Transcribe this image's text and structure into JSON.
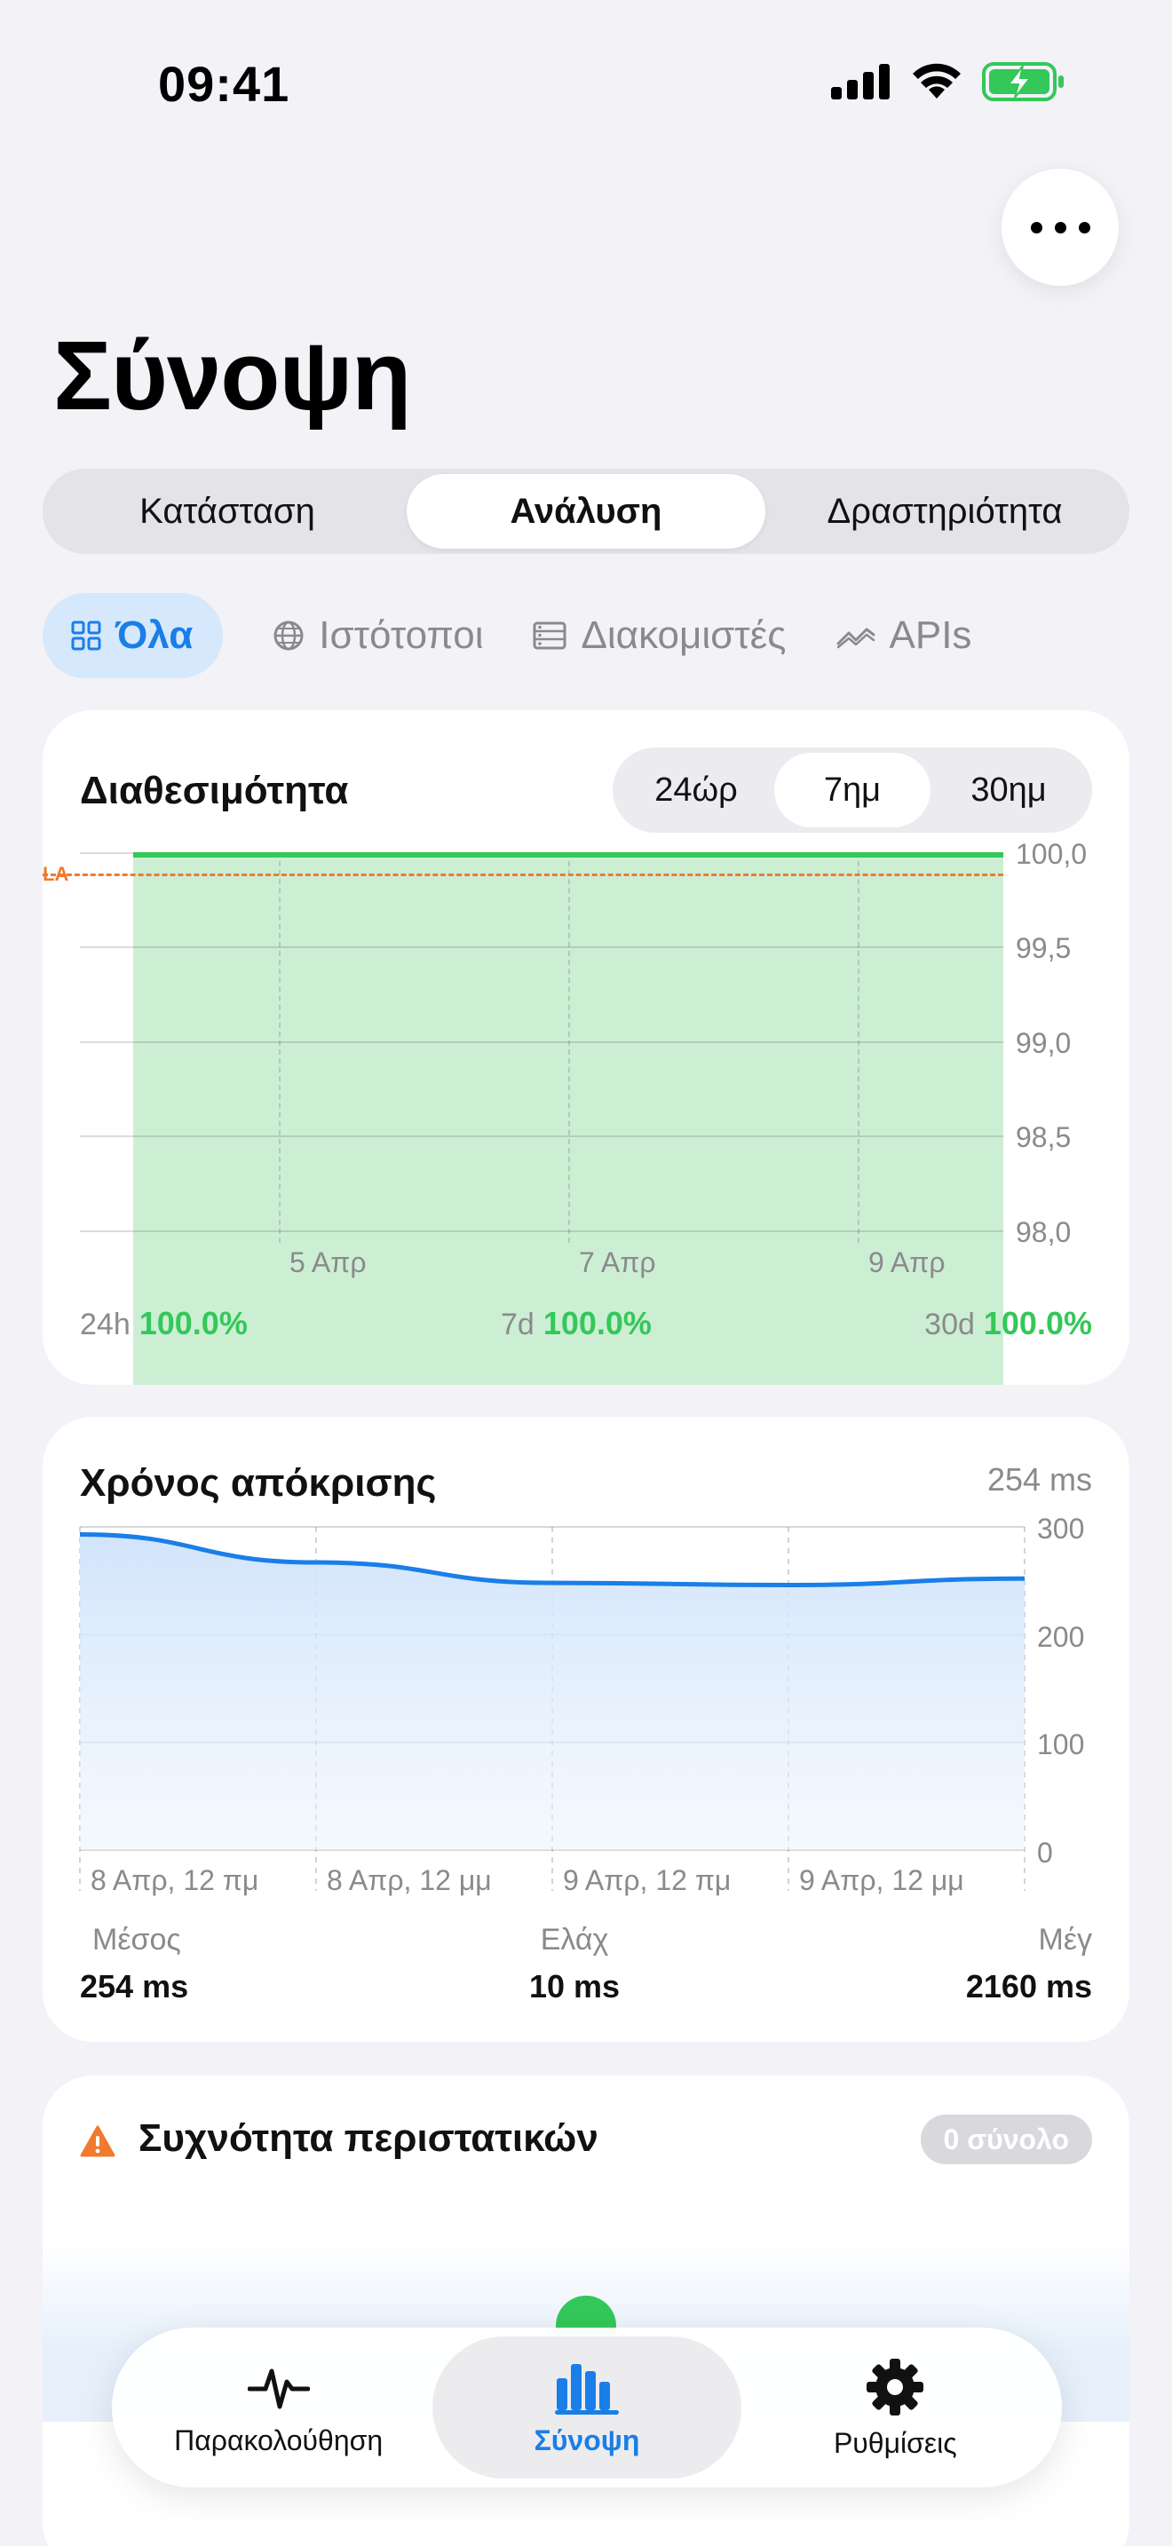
{
  "status": {
    "time": "09:41"
  },
  "header": {
    "title": "Σύνοψη"
  },
  "segments": [
    {
      "label": "Κατάσταση"
    },
    {
      "label": "Ανάλυση",
      "active": true
    },
    {
      "label": "Δραστηριότητα"
    }
  ],
  "filters": [
    {
      "label": "Όλα",
      "icon": "grid-icon",
      "active": true
    },
    {
      "label": "Ιστότοποι",
      "icon": "globe-icon"
    },
    {
      "label": "Διακομιστές",
      "icon": "server-icon"
    },
    {
      "label": "APIs",
      "icon": "api-icon"
    }
  ],
  "availability": {
    "title": "Διαθεσιμότητα",
    "ranges": [
      "24ώρ",
      "7ημ",
      "30ημ"
    ],
    "active_range": "7ημ",
    "sla_label": "LA",
    "summary": [
      {
        "period": "24h",
        "value": "100.0%"
      },
      {
        "period": "7d",
        "value": "100.0%"
      },
      {
        "period": "30d",
        "value": "100.0%"
      }
    ]
  },
  "response": {
    "title": "Χρόνος απόκρισης",
    "current": "254 ms",
    "stats": [
      {
        "label": "Μέσος",
        "value": "254 ms"
      },
      {
        "label": "Ελάχ",
        "value": "10 ms"
      },
      {
        "label": "Μέγ",
        "value": "2160 ms"
      }
    ]
  },
  "incidents": {
    "title": "Συχνότητα περιστατικών",
    "badge": "0 σύνολο"
  },
  "tabbar": [
    {
      "label": "Παρακολούθηση",
      "icon": "heartbeat-icon"
    },
    {
      "label": "Σύνοψη",
      "icon": "bar-chart-icon",
      "active": true
    },
    {
      "label": "Ρυθμίσεις",
      "icon": "gear-icon"
    }
  ],
  "colors": {
    "accent": "#1a7ee8",
    "success": "#34c759",
    "sla": "#f07a2e",
    "warning": "#f07a2e"
  },
  "chart_data": [
    {
      "type": "area",
      "x": [
        "4 Απρ",
        "5 Απρ",
        "6 Απρ",
        "7 Απρ",
        "8 Απρ",
        "9 Απρ",
        "10 Απρ"
      ],
      "x_tick_labels": [
        "5 Απρ",
        "7 Απρ",
        "9 Απρ"
      ],
      "y_tick_labels": [
        "100,0",
        "99,5",
        "99,0",
        "98,5",
        "98,0"
      ],
      "series": [
        {
          "values": [
            100,
            100,
            100,
            100,
            100,
            100,
            100
          ]
        }
      ],
      "sla": 99.9,
      "ylim": [
        98,
        100
      ],
      "grid": true
    },
    {
      "type": "area",
      "x": [
        "8 Απρ, 12 πμ",
        "8 Απρ, 12 μμ",
        "9 Απρ, 12 πμ",
        "9 Απρ, 12 μμ",
        "10 Απρ, 12 πμ"
      ],
      "x_tick_labels": [
        "8 Απρ, 12 πμ",
        "8 Απρ, 12 μμ",
        "9 Απρ, 12 πμ",
        "9 Απρ, 12 μμ"
      ],
      "y_tick_labels": [
        "300",
        "200",
        "100",
        "0"
      ],
      "series": [
        {
          "values": [
            293,
            267,
            248,
            246,
            252
          ]
        }
      ],
      "ylim": [
        0,
        300
      ],
      "grid": true
    }
  ]
}
